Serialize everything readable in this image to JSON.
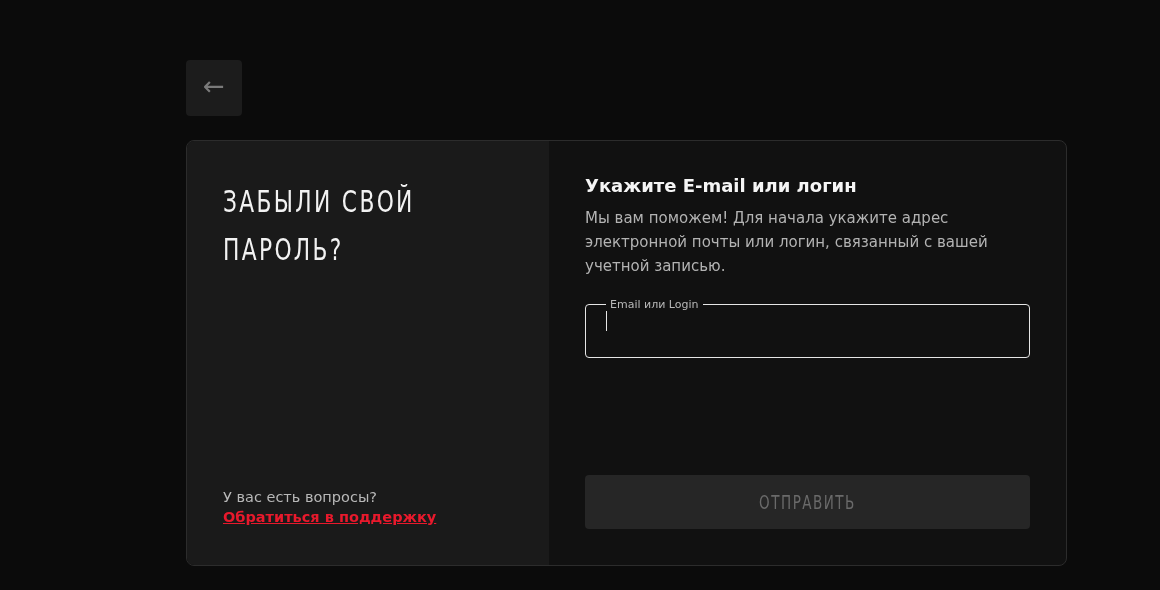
{
  "back_button": {
    "icon": "←"
  },
  "left_panel": {
    "title_lines": [
      "ЗАБЫЛИ СВОЙ",
      "ПАРОЛЬ?"
    ],
    "question": "У вас есть вопросы?",
    "support_link": "Обратиться в поддержку"
  },
  "form": {
    "heading": "Укажите E-mail или логин",
    "description": "Мы вам поможем! Для начала укажите адрес электронной почты или логин, связанный с вашей учетной записью.",
    "field": {
      "label": "Email или Login",
      "focused": true
    },
    "submit": {
      "label": "ОТПРАВИТЬ",
      "disabled": true
    }
  }
}
